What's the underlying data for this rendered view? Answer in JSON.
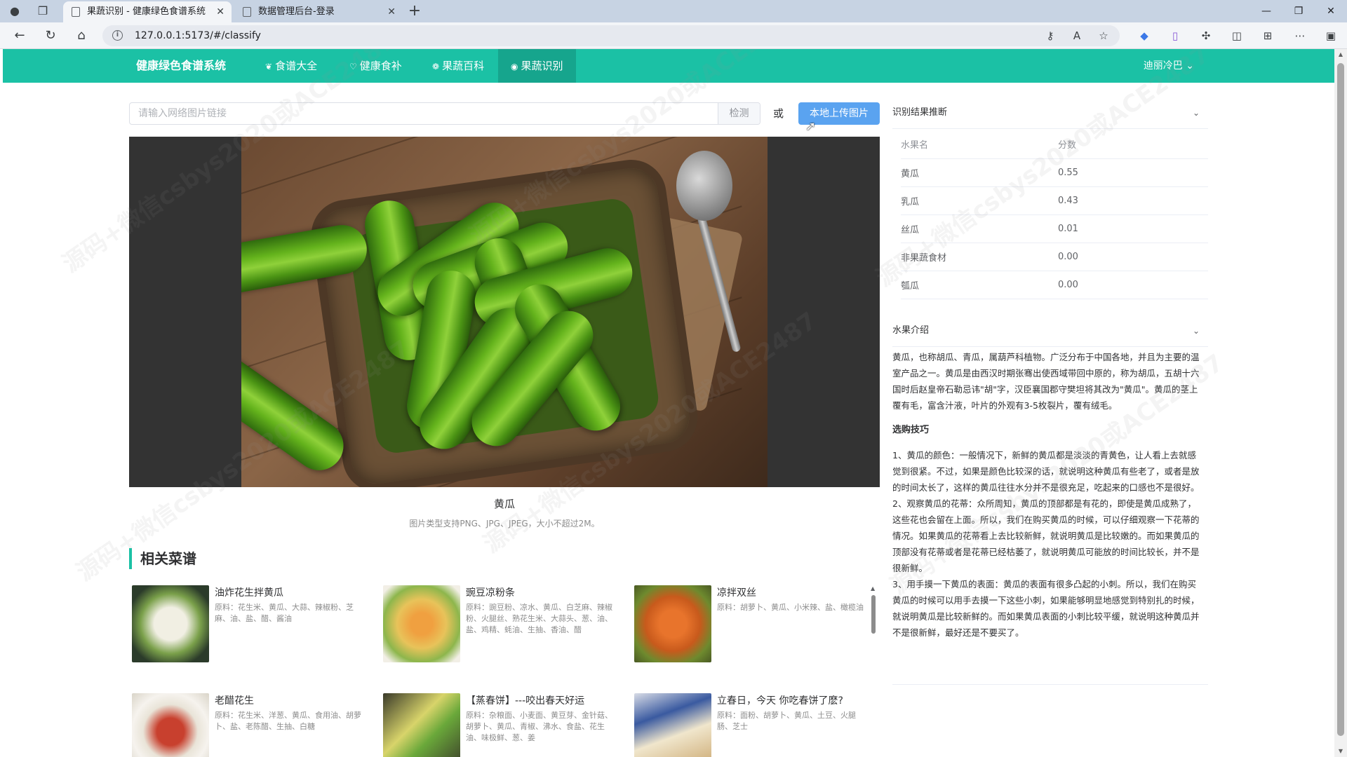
{
  "browser": {
    "tabs": [
      {
        "title": "果蔬识别 - 健康绿色食谱系统",
        "active": true
      },
      {
        "title": "数据管理后台-登录",
        "active": false
      }
    ],
    "url": "127.0.0.1:5173/#/classify"
  },
  "nav": {
    "brand": "健康绿色食谱系统",
    "items": [
      {
        "label": "食谱大全",
        "icon": "leaf-icon"
      },
      {
        "label": "健康食补",
        "icon": "heart-icon"
      },
      {
        "label": "果蔬百科",
        "icon": "apple-icon"
      },
      {
        "label": "果蔬识别",
        "icon": "camera-icon",
        "active": true
      }
    ],
    "user": "迪丽冷巴"
  },
  "search": {
    "placeholder": "请输入网络图片链接",
    "detect_label": "检测",
    "or_label": "或",
    "upload_label": "本地上传图片"
  },
  "result": {
    "name": "黄瓜",
    "hint": "图片类型支持PNG、JPG、JPEG，大小不超过2M。"
  },
  "related": {
    "title": "相关菜谱",
    "recipes": [
      {
        "title": "油炸花生拌黄瓜",
        "desc": "原料：花生米、黄瓜、大蒜、辣椒粉、芝麻、油、盐、醋、酱油"
      },
      {
        "title": "豌豆凉粉条",
        "desc": "原料：豌豆粉、凉水、黄瓜、白芝麻、辣椒粉、火腿丝、熟花生米、大蒜头、葱、油、盐、鸡精、蚝油、生抽、香油、醋"
      },
      {
        "title": "凉拌双丝",
        "desc": "原料：胡萝卜、黄瓜、小米辣、盐、橄榄油"
      },
      {
        "title": "老醋花生",
        "desc": "原料：花生米、洋葱、黄瓜、食用油、胡萝卜、盐、老陈醋、生抽、白糖"
      },
      {
        "title": "【蒸春饼】---咬出春天好运",
        "desc": "原料：杂粮面、小麦面、黄豆芽、金针菇、胡萝卜、黄瓜、青椒、沸水、食盐、花生油、味极鲜、葱、姜"
      },
      {
        "title": "立春日，今天 你吃春饼了麽?",
        "desc": "原料：面粉、胡萝卜、黄瓜、土豆、火腿肠、芝士"
      }
    ]
  },
  "recognition": {
    "title": "识别结果推断",
    "columns": [
      "水果名",
      "分数"
    ],
    "rows": [
      {
        "name": "黄瓜",
        "score": "0.55"
      },
      {
        "name": "乳瓜",
        "score": "0.43"
      },
      {
        "name": "丝瓜",
        "score": "0.01"
      },
      {
        "name": "非果蔬食材",
        "score": "0.00"
      },
      {
        "name": "瓠瓜",
        "score": "0.00"
      }
    ]
  },
  "intro": {
    "title": "水果介绍",
    "text": "黄瓜，也称胡瓜、青瓜，属葫芦科植物。广泛分布于中国各地，并且为主要的温室产品之一。黄瓜是由西汉时期张骞出使西域带回中原的，称为胡瓜，五胡十六国时后赵皇帝石勒忌讳\"胡\"字，汉臣襄国郡守樊坦将其改为\"黄瓜\"。黄瓜的茎上覆有毛，富含汁液，叶片的外观有3-5枚裂片，覆有绒毛。",
    "tips_title": "选购技巧",
    "tips": [
      "1、黄瓜的颜色：一般情况下，新鲜的黄瓜都是淡淡的青黄色，让人看上去就感觉到很紧。不过，如果是颜色比较深的话，就说明这种黄瓜有些老了，或者是放的时间太长了，这样的黄瓜往往水分并不是很充足，吃起来的口感也不是很好。",
      "2、观察黄瓜的花蒂：众所周知，黄瓜的顶部都是有花的，即使是黄瓜成熟了，这些花也会留在上面。所以，我们在购买黄瓜的时候，可以仔细观察一下花蒂的情况。如果黄瓜的花蒂看上去比较新鲜，就说明黄瓜是比较嫩的。而如果黄瓜的顶部没有花蒂或者是花蒂已经枯萎了，就说明黄瓜可能放的时间比较长，并不是很新鲜。",
      "3、用手摸一下黄瓜的表面：黄瓜的表面有很多凸起的小刺。所以，我们在购买黄瓜的时候可以用手去摸一下这些小刺，如果能够明显地感觉到特别扎的时候，就说明黄瓜是比较新鲜的。而如果黄瓜表面的小刺比较平缓，就说明这种黄瓜并不是很新鲜，最好还是不要买了。"
    ]
  },
  "watermark": "源码+微信csbys2020或ACE2487"
}
